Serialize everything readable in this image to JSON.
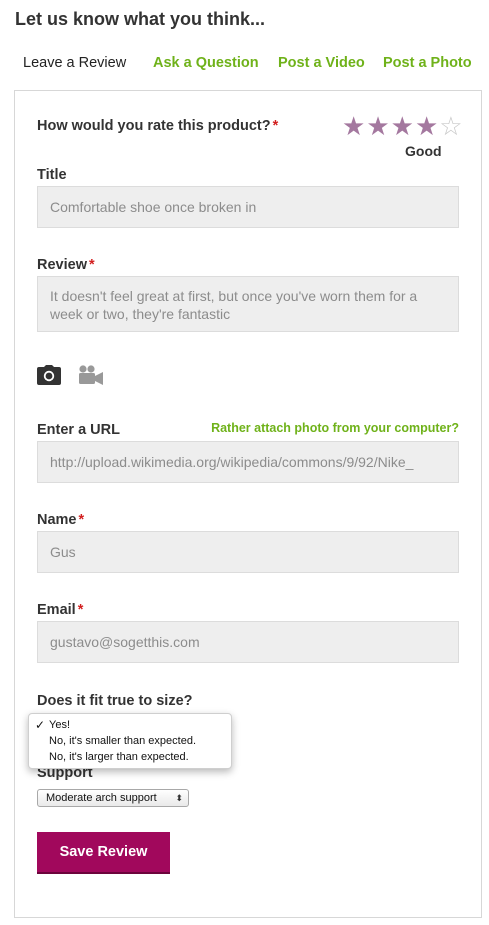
{
  "page": {
    "title": "Let us know what you think..."
  },
  "tabs": [
    {
      "label": "Leave a Review",
      "active": true
    },
    {
      "label": "Ask a Question"
    },
    {
      "label": "Post a Video"
    },
    {
      "label": "Post a Photo"
    }
  ],
  "rating": {
    "question": "How would you rate this product?",
    "required_mark": "*",
    "value": 4,
    "max": 5,
    "word": "Good",
    "filled_color": "#a4789f",
    "empty_color": "#c9c9c9",
    "star_glyph": "★",
    "empty_star_glyph": "☆"
  },
  "title_field": {
    "label": "Title",
    "value": "Comfortable shoe once broken in"
  },
  "review_field": {
    "label": "Review",
    "required_mark": "*",
    "value": "It doesn't feel great at first, but once you've worn them for a week or two, they're fantastic"
  },
  "media": {
    "icons": [
      "camera-icon",
      "video-camera-icon"
    ]
  },
  "url_field": {
    "label": "Enter a URL",
    "attach_link": "Rather attach photo from your computer?",
    "value": "http://upload.wikimedia.org/wikipedia/commons/9/92/Nike_"
  },
  "name_field": {
    "label": "Name",
    "required_mark": "*",
    "value": "Gus"
  },
  "email_field": {
    "label": "Email",
    "required_mark": "*",
    "value": "gustavo@sogetthis.com"
  },
  "fit": {
    "question": "Does it fit true to size?",
    "check_glyph": "✓",
    "options": [
      {
        "label": "Yes!",
        "selected": true
      },
      {
        "label": "No, it's smaller than expected."
      },
      {
        "label": "No, it's larger than expected."
      }
    ]
  },
  "support": {
    "label": "Support",
    "selected": "Moderate arch support",
    "arrow": "⬍"
  },
  "save_label": "Save Review",
  "colors": {
    "accent_green": "#6fb21a",
    "button": "#a1085c",
    "required": "#d21f1f"
  }
}
